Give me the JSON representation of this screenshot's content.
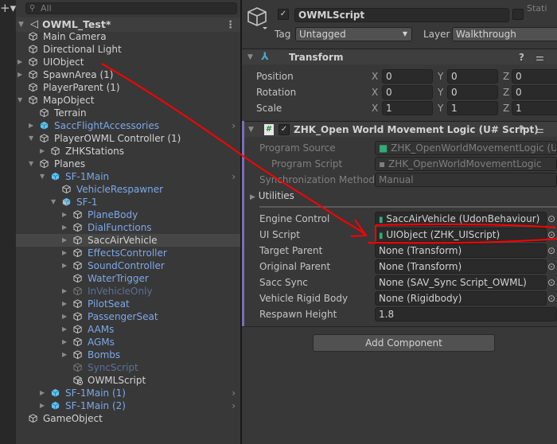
{
  "hierarchy": {
    "search_placeholder": "All",
    "scene": "OWML_Test*",
    "items": [
      {
        "label": "Main Camera",
        "depth": 1,
        "arrow": "none",
        "color": "white",
        "icon": "cube"
      },
      {
        "label": "Directional Light",
        "depth": 1,
        "arrow": "none",
        "color": "white",
        "icon": "cube"
      },
      {
        "label": "UIObject",
        "depth": 1,
        "arrow": "collapsed",
        "color": "white",
        "icon": "cube"
      },
      {
        "label": "SpawnArea (1)",
        "depth": 1,
        "arrow": "collapsed",
        "color": "white",
        "icon": "cube"
      },
      {
        "label": "PlayerParent (1)",
        "depth": 1,
        "arrow": "none",
        "color": "white",
        "icon": "cube"
      },
      {
        "label": "MapObject",
        "depth": 1,
        "arrow": "expanded",
        "color": "white",
        "icon": "cube"
      },
      {
        "label": "Terrain",
        "depth": 2,
        "arrow": "none",
        "color": "white",
        "icon": "cube"
      },
      {
        "label": "SaccFlightAccessories",
        "depth": 2,
        "arrow": "collapsed",
        "color": "blue",
        "icon": "prefab",
        "chevron": true
      },
      {
        "label": "PlayerOWML Controller (1)",
        "depth": 2,
        "arrow": "expanded",
        "color": "white",
        "icon": "cube"
      },
      {
        "label": "ZHKStations",
        "depth": 3,
        "arrow": "collapsed",
        "color": "white",
        "icon": "cube"
      },
      {
        "label": "Planes",
        "depth": 2,
        "arrow": "expanded",
        "color": "white",
        "icon": "cube"
      },
      {
        "label": "SF-1Main",
        "depth": 3,
        "arrow": "expanded",
        "color": "blue",
        "icon": "prefab",
        "chevron": true
      },
      {
        "label": "VehicleRespawner",
        "depth": 4,
        "arrow": "none",
        "color": "blue",
        "icon": "cube"
      },
      {
        "label": "SF-1",
        "depth": 4,
        "arrow": "expanded",
        "color": "blue",
        "icon": "prefab-variant"
      },
      {
        "label": "PlaneBody",
        "depth": 5,
        "arrow": "collapsed",
        "color": "blue",
        "icon": "cube"
      },
      {
        "label": "DialFunctions",
        "depth": 5,
        "arrow": "collapsed",
        "color": "blue",
        "icon": "cube"
      },
      {
        "label": "SaccAirVehicle",
        "depth": 5,
        "arrow": "collapsed",
        "color": "white",
        "icon": "cube",
        "selected": true
      },
      {
        "label": "EffectsController",
        "depth": 5,
        "arrow": "collapsed",
        "color": "blue",
        "icon": "cube"
      },
      {
        "label": "SoundController",
        "depth": 5,
        "arrow": "collapsed",
        "color": "blue",
        "icon": "cube"
      },
      {
        "label": "WaterTrigger",
        "depth": 5,
        "arrow": "none",
        "color": "blue",
        "icon": "cube"
      },
      {
        "label": "InVehicleOnly",
        "depth": 5,
        "arrow": "collapsed",
        "color": "dim",
        "icon": "cube"
      },
      {
        "label": "PilotSeat",
        "depth": 5,
        "arrow": "collapsed",
        "color": "blue",
        "icon": "cube"
      },
      {
        "label": "PassengerSeat",
        "depth": 5,
        "arrow": "collapsed",
        "color": "blue",
        "icon": "cube"
      },
      {
        "label": "AAMs",
        "depth": 5,
        "arrow": "collapsed",
        "color": "blue",
        "icon": "cube"
      },
      {
        "label": "AGMs",
        "depth": 5,
        "arrow": "collapsed",
        "color": "blue",
        "icon": "cube"
      },
      {
        "label": "Bombs",
        "depth": 5,
        "arrow": "collapsed",
        "color": "blue",
        "icon": "cube"
      },
      {
        "label": "SyncScript",
        "depth": 5,
        "arrow": "none",
        "color": "dim",
        "icon": "cube"
      },
      {
        "label": "OWMLScript",
        "depth": 5,
        "arrow": "none",
        "color": "white",
        "icon": "cube-added"
      },
      {
        "label": "SF-1Main (1)",
        "depth": 3,
        "arrow": "collapsed",
        "color": "blue",
        "icon": "prefab",
        "chevron": true
      },
      {
        "label": "SF-1Main (2)",
        "depth": 3,
        "arrow": "collapsed",
        "color": "blue",
        "icon": "prefab",
        "chevron": true
      },
      {
        "label": "GameObject",
        "depth": 1,
        "arrow": "none",
        "color": "white",
        "icon": "cube"
      }
    ]
  },
  "inspector": {
    "object_name": "OWMLScript",
    "static_label": "Stati",
    "tag_label": "Tag",
    "tag_value": "Untagged",
    "layer_label": "Layer",
    "layer_value": "Walkthrough",
    "transform": {
      "title": "Transform",
      "rows": [
        {
          "label": "Position",
          "x": "0",
          "y": "0",
          "z": "0"
        },
        {
          "label": "Rotation",
          "x": "0",
          "y": "0",
          "z": "0"
        },
        {
          "label": "Scale",
          "x": "1",
          "y": "1",
          "z": "1"
        }
      ]
    },
    "component": {
      "title": "ZHK_Open World Movement Logic (U# Script)",
      "program_source_label": "Program Source",
      "program_source": "ZHK_OpenWorldMovementLogic (U",
      "program_script_label": "Program Script",
      "program_script": "ZHK_OpenWorldMovementLogic",
      "sync_label": "Synchronization Method",
      "sync_value": "Manual",
      "utilities_label": "Utilities",
      "fields": [
        {
          "label": "Engine Control",
          "value": "SaccAirVehicle (UdonBehaviour)",
          "icon": true
        },
        {
          "label": "UI Script",
          "value": "UIObject (ZHK_UIScript)",
          "icon": true
        },
        {
          "label": "Target Parent",
          "value": "None (Transform)"
        },
        {
          "label": "Original Parent",
          "value": "None (Transform)"
        },
        {
          "label": "Sacc Sync",
          "value": "None (SAV_Sync Script_OWML)"
        },
        {
          "label": "Vehicle Rigid Body",
          "value": "None (Rigidbody)"
        },
        {
          "label": "Respawn Height",
          "value": "1.8",
          "plain": true
        }
      ]
    },
    "add_component": "Add Component"
  },
  "colors": {
    "annotation": "#ff0000",
    "selection": "#464646",
    "prefab_text": "#7ca8e8",
    "component_bar": "#7b6fb8"
  }
}
